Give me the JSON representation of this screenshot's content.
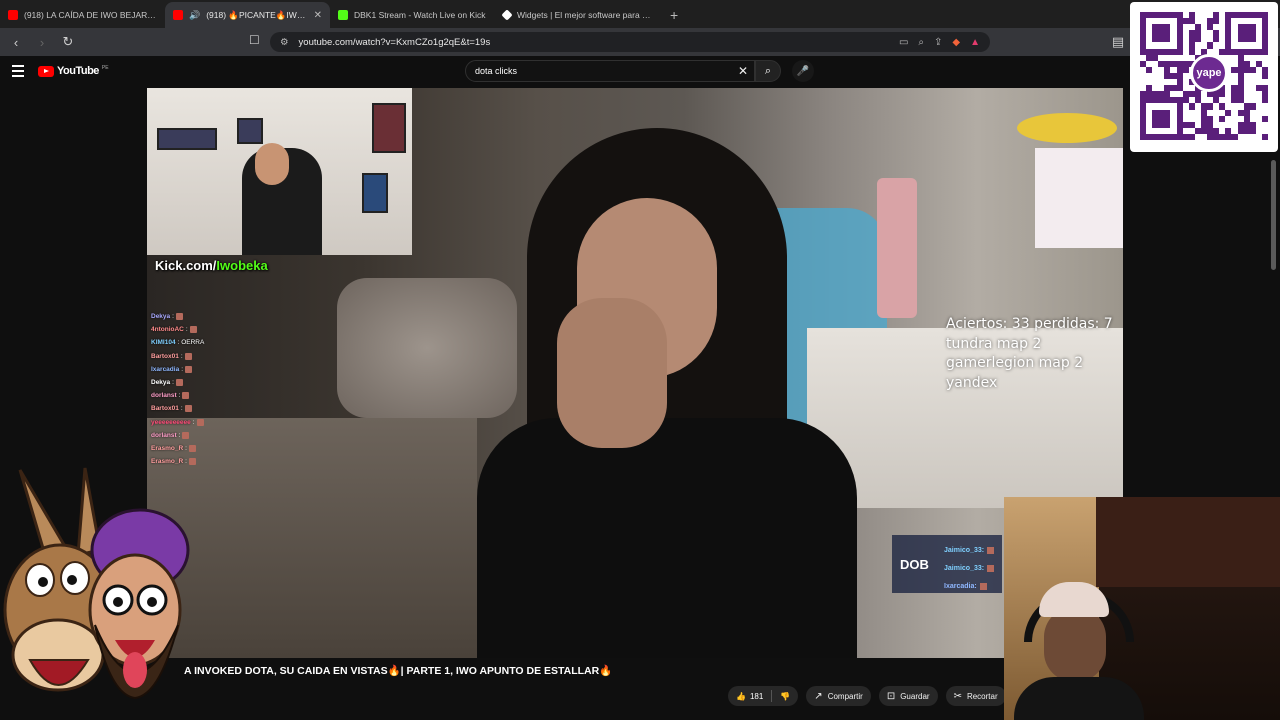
{
  "browser": {
    "tabs": [
      {
        "title": "(918) LA CAÍDA DE IWO BEJAR EL ST",
        "favicon_color": "#ff0000",
        "active": false
      },
      {
        "title": "(918) 🔥PICANTE🔥IWO REAC",
        "favicon_color": "#ff0000",
        "active": true
      },
      {
        "title": "DBK1 Stream - Watch Live on Kick",
        "favicon_color": "#53fc18",
        "active": false
      },
      {
        "title": "Widgets | El mejor software para pot",
        "favicon_color": "#ffffff",
        "active": false
      }
    ],
    "close_glyph": "✕",
    "newtab_glyph": "+",
    "url": "youtube.com/watch?v=KxmCZo1g2qE&t=19s"
  },
  "youtube": {
    "logo_text": "YouTube",
    "region": "PE",
    "search_value": "dota clicks",
    "clear_glyph": "✕"
  },
  "qr": {
    "badge_text": "yape"
  },
  "video": {
    "kick_prefix": "Kick.com/",
    "kick_user": "Iwobeka",
    "chat": [
      {
        "name": "Dekya",
        "color": "#a9a9ff",
        "msg": ":"
      },
      {
        "name": "4ntonioAC",
        "color": "#ff8a8a",
        "msg": ":"
      },
      {
        "name": "KIMI104",
        "color": "#7fd0ff",
        "msg": ": OERRA"
      },
      {
        "name": "Bartox01",
        "color": "#ff9e9e",
        "msg": ":"
      },
      {
        "name": "Ixarcadia",
        "color": "#8fb7ff",
        "msg": ":"
      },
      {
        "name": "Dekya",
        "color": "#ffffff",
        "msg": ":"
      },
      {
        "name": "dorlanst",
        "color": "#ff9ec8",
        "msg": ":"
      },
      {
        "name": "Bartox01",
        "color": "#ff9e9e",
        "msg": ":"
      },
      {
        "name": "yeeeeeeeeee",
        "color": "#ff4d7a",
        "msg": ":"
      },
      {
        "name": "dorlanst",
        "color": "#ff9ec8",
        "msg": ":"
      },
      {
        "name": "Erasmo_R",
        "color": "#ff9e9e",
        "msg": ":"
      },
      {
        "name": "Erasmo_R",
        "color": "#ff9e9e",
        "msg": ":"
      }
    ],
    "stats": [
      "Aciertos: 33 perdidas: 7",
      "tundra map 2",
      "gamerlegion map 2",
      "yandex"
    ],
    "mini_chat": {
      "label": "DOB",
      "lines": [
        "Jaimico_33:",
        "Jaimico_33:",
        "Ixarcadia:"
      ]
    },
    "title": "A INVOKED DOTA, SU CAIDA EN VISTAS🔥| PARTE 1, IWO APUNTO DE ESTALLAR🔥"
  },
  "actions": {
    "like_count": "181",
    "share": "Compartir",
    "save": "Guardar",
    "clip": "Recortar",
    "more": "⋯"
  }
}
